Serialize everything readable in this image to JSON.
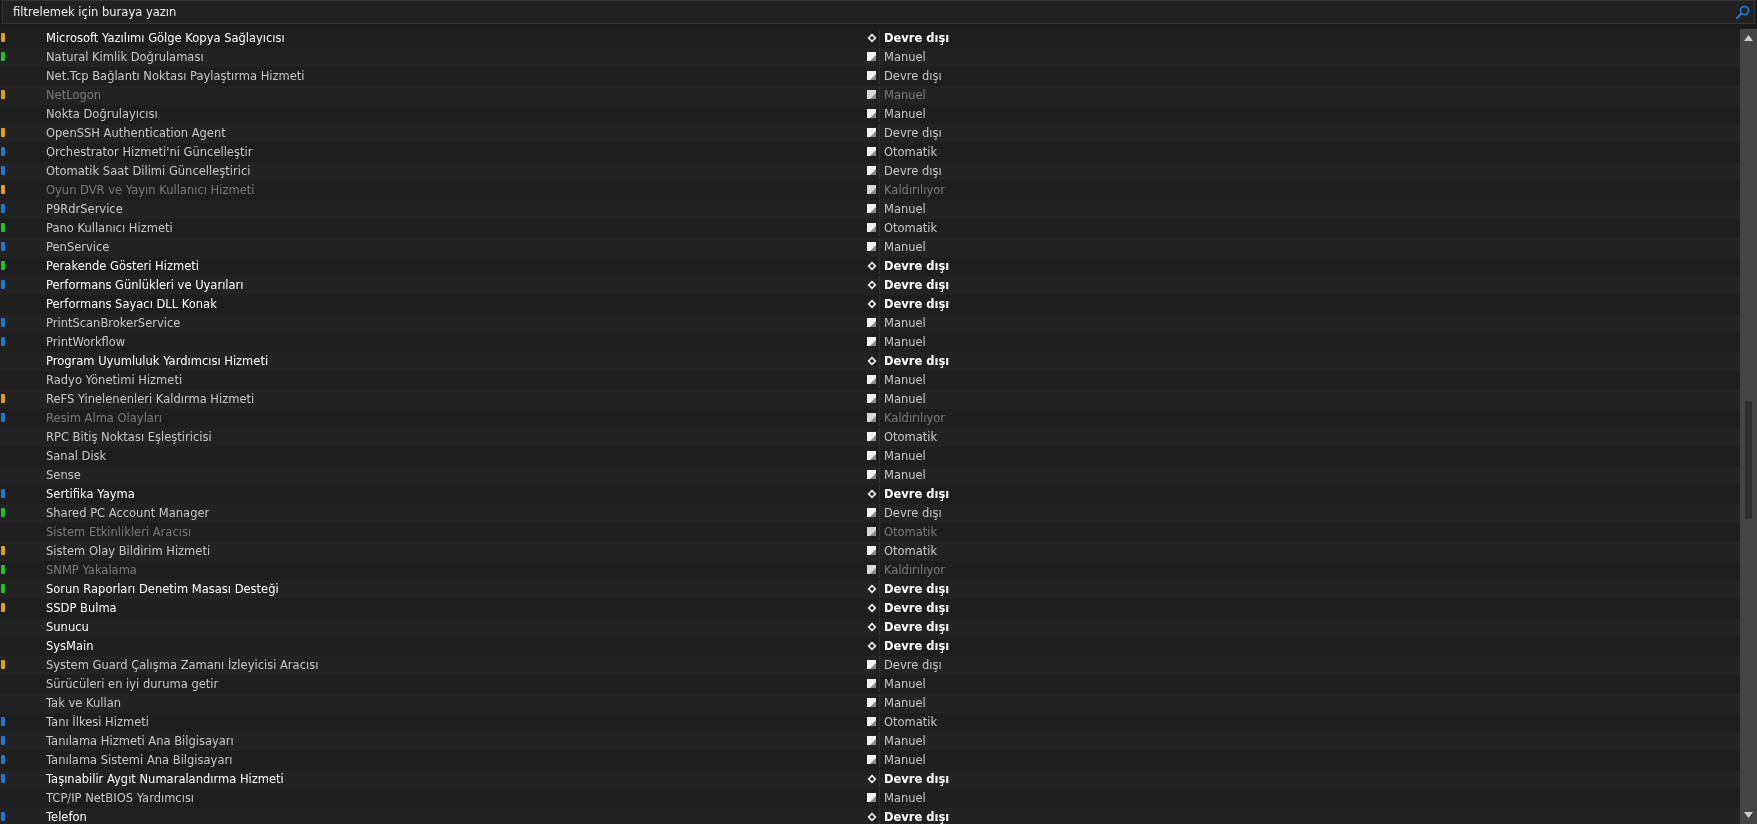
{
  "search": {
    "placeholder": "filtrelemek için buraya yazın"
  },
  "services": [
    {
      "name": "Microsoft Yazılımı Gölge Kopya Sağlayıcısı",
      "color": "#e0a21c",
      "kind": "highlighted",
      "status": "Devre dışı"
    },
    {
      "name": "Natural Kimlik Doğrulaması",
      "color": "#21c12b",
      "kind": "normal",
      "status": "Manuel"
    },
    {
      "name": "Net.Tcp Bağlantı Noktası Paylaştırma Hizmeti",
      "kind": "normal",
      "status": "Devre dışı"
    },
    {
      "name": "NetLogon",
      "color": "#e0a21c",
      "kind": "dimmed",
      "status": "Manuel"
    },
    {
      "name": "Nokta Doğrulayıcısı",
      "kind": "normal",
      "status": "Manuel"
    },
    {
      "name": "OpenSSH Authentication Agent",
      "color": "#e0a21c",
      "kind": "normal",
      "status": "Devre dışı"
    },
    {
      "name": "Orchestrator Hizmeti'ni Güncelleştir",
      "color": "#1f78d1",
      "kind": "normal",
      "status": "Otomatik"
    },
    {
      "name": "Otomatik Saat Dilimi Güncelleştirici",
      "color": "#1f78d1",
      "kind": "normal",
      "status": "Devre dışı"
    },
    {
      "name": "Oyun DVR ve Yayın Kullanıcı Hizmeti",
      "color": "#e0a21c",
      "kind": "dimmed",
      "status": "Kaldırılıyor"
    },
    {
      "name": "P9RdrService",
      "color": "#1f78d1",
      "kind": "normal",
      "status": "Manuel"
    },
    {
      "name": "Pano Kullanıcı Hizmeti",
      "color": "#21c12b",
      "kind": "normal",
      "status": "Otomatik"
    },
    {
      "name": "PenService",
      "color": "#1f78d1",
      "kind": "normal",
      "status": "Manuel"
    },
    {
      "name": "Perakende Gösteri Hizmeti",
      "color": "#21c12b",
      "kind": "highlighted",
      "status": "Devre dışı"
    },
    {
      "name": "Performans Günlükleri ve Uyarıları",
      "color": "#1f78d1",
      "kind": "highlighted",
      "status": "Devre dışı"
    },
    {
      "name": "Performans Sayacı DLL Konak",
      "kind": "highlighted",
      "status": "Devre dışı"
    },
    {
      "name": "PrintScanBrokerService",
      "color": "#1f78d1",
      "kind": "normal",
      "status": "Manuel"
    },
    {
      "name": "PrintWorkflow",
      "color": "#1f78d1",
      "kind": "normal",
      "status": "Manuel"
    },
    {
      "name": "Program Uyumluluk Yardımcısı Hizmeti",
      "kind": "highlighted",
      "status": "Devre dışı"
    },
    {
      "name": "Radyo Yönetimi Hizmeti",
      "kind": "normal",
      "status": "Manuel"
    },
    {
      "name": "ReFS Yinelenenleri Kaldırma Hizmeti",
      "color": "#e0a21c",
      "kind": "normal",
      "status": "Manuel"
    },
    {
      "name": "Resim Alma Olayları",
      "color": "#1f78d1",
      "kind": "dimmed",
      "status": "Kaldırılıyor"
    },
    {
      "name": "RPC Bitiş Noktası Eşleştiricisi",
      "kind": "normal",
      "status": "Otomatik"
    },
    {
      "name": "Sanal Disk",
      "kind": "normal",
      "status": "Manuel"
    },
    {
      "name": "Sense",
      "kind": "normal",
      "status": "Manuel"
    },
    {
      "name": "Sertifika Yayma",
      "color": "#1f78d1",
      "kind": "highlighted",
      "status": "Devre dışı"
    },
    {
      "name": "Shared PC Account Manager",
      "color": "#21c12b",
      "kind": "normal",
      "status": "Devre dışı"
    },
    {
      "name": "Sistem Etkinlikleri Aracısı",
      "kind": "dimmed",
      "status": "Otomatik"
    },
    {
      "name": "Sistem Olay Bildirim Hizmeti",
      "color": "#e0a21c",
      "kind": "normal",
      "status": "Otomatik"
    },
    {
      "name": "SNMP Yakalama",
      "color": "#21c12b",
      "kind": "dimmed",
      "status": "Kaldırılıyor"
    },
    {
      "name": "Sorun Raporları Denetim Masası Desteği",
      "color": "#21c12b",
      "kind": "highlighted",
      "status": "Devre dışı"
    },
    {
      "name": "SSDP Bulma",
      "color": "#e0a21c",
      "kind": "highlighted",
      "status": "Devre dışı"
    },
    {
      "name": "Sunucu",
      "kind": "highlighted",
      "status": "Devre dışı"
    },
    {
      "name": "SysMain",
      "kind": "highlighted",
      "status": "Devre dışı"
    },
    {
      "name": "System Guard Çalışma Zamanı İzleyicisi Aracısı",
      "color": "#e0a21c",
      "kind": "normal",
      "status": "Devre dışı"
    },
    {
      "name": "Sürücüleri en iyi duruma getir",
      "kind": "normal",
      "status": "Manuel"
    },
    {
      "name": "Tak ve Kullan",
      "kind": "normal",
      "status": "Manuel"
    },
    {
      "name": "Tanı İlkesi Hizmeti",
      "color": "#1f78d1",
      "kind": "normal",
      "status": "Otomatik"
    },
    {
      "name": "Tanılama Hizmeti Ana Bilgisayarı",
      "color": "#1f78d1",
      "kind": "normal",
      "status": "Manuel"
    },
    {
      "name": "Tanılama Sistemi Ana Bilgisayarı",
      "color": "#1f78d1",
      "kind": "normal",
      "status": "Manuel"
    },
    {
      "name": "Taşınabilir Aygıt Numaralandırma Hizmeti",
      "color": "#1f78d1",
      "kind": "highlighted",
      "status": "Devre dışı"
    },
    {
      "name": "TCP/IP NetBIOS Yardımcısı",
      "kind": "normal",
      "status": "Manuel"
    },
    {
      "name": "Telefon",
      "color": "#1f78d1",
      "kind": "highlighted",
      "status": "Devre dışı"
    }
  ]
}
